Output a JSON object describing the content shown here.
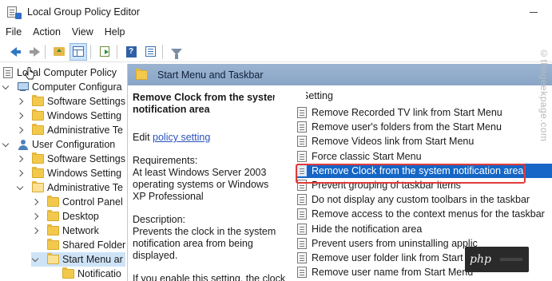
{
  "window": {
    "title": "Local Group Policy Editor",
    "minimize_icon": "minimize-icon"
  },
  "menu": [
    "File",
    "Action",
    "View",
    "Help"
  ],
  "toolbar": {
    "icons": [
      "back-arrow-icon",
      "forward-arrow-icon",
      "up-folder-icon",
      "show-hide-tree-icon",
      "export-list-icon",
      "help-icon",
      "properties-icon",
      "filter-icon"
    ]
  },
  "tree": {
    "items": [
      {
        "label": "Local Computer Policy",
        "level": 0,
        "icon": "policy-icon"
      },
      {
        "label": "Computer Configura",
        "level": 1,
        "icon": "computer-icon",
        "expanded": true
      },
      {
        "label": "Software Settings",
        "level": 2,
        "icon": "folder-icon"
      },
      {
        "label": "Windows Setting",
        "level": 2,
        "icon": "folder-icon"
      },
      {
        "label": "Administrative Te",
        "level": 2,
        "icon": "folder-icon"
      },
      {
        "label": "User Configuration",
        "level": 1,
        "icon": "user-icon",
        "expanded": true
      },
      {
        "label": "Software Settings",
        "level": 2,
        "icon": "folder-icon"
      },
      {
        "label": "Windows Setting",
        "level": 2,
        "icon": "folder-icon"
      },
      {
        "label": "Administrative Te",
        "level": 2,
        "icon": "folder-icon",
        "expanded": true
      },
      {
        "label": "Control Panel",
        "level": 3,
        "icon": "folder-icon"
      },
      {
        "label": "Desktop",
        "level": 3,
        "icon": "folder-icon"
      },
      {
        "label": "Network",
        "level": 3,
        "icon": "folder-icon"
      },
      {
        "label": "Shared Folder",
        "level": 3,
        "icon": "folder-icon"
      },
      {
        "label": "Start Menu ar",
        "level": 3,
        "icon": "folder-icon",
        "expanded": true,
        "selected": true
      },
      {
        "label": "Notificatio",
        "level": 4,
        "icon": "folder-icon"
      }
    ]
  },
  "pane": {
    "header": "Start Menu and Taskbar",
    "column_header": "Setting"
  },
  "description": {
    "title": "Remove Clock from the system notification area",
    "edit_prefix": "Edit",
    "edit_link": "policy setting",
    "requirements_label": "Requirements:",
    "requirements_text": "At least Windows Server 2003 operating systems or Windows XP Professional",
    "description_label": "Description:",
    "description_text": "Prevents the clock in the system notification area from being displayed.",
    "more_text": "If you enable this setting, the clock"
  },
  "settings": [
    "Remove Recorded TV link from Start Menu",
    "Remove user's folders from the Start Menu",
    "Remove Videos link from Start Menu",
    "Force classic Start Menu",
    "Remove Clock from the system notification area",
    "Prevent grouping of taskbar items",
    "Do not display any custom toolbars in the taskbar",
    "Remove access to the context menus for the taskbar",
    "Hide the notification area",
    "Prevent users from uninstalling applic",
    "Remove user folder link from Start Me",
    "Remove user name from Start Menu"
  ],
  "selected_setting_index": 4,
  "watermark": "©thegeekpage.com",
  "badge": "php",
  "colors": {
    "selection": "#1566c6",
    "highlight_border": "#e23a3a",
    "pane_header": "#9bb4d1",
    "link": "#2a52be"
  }
}
